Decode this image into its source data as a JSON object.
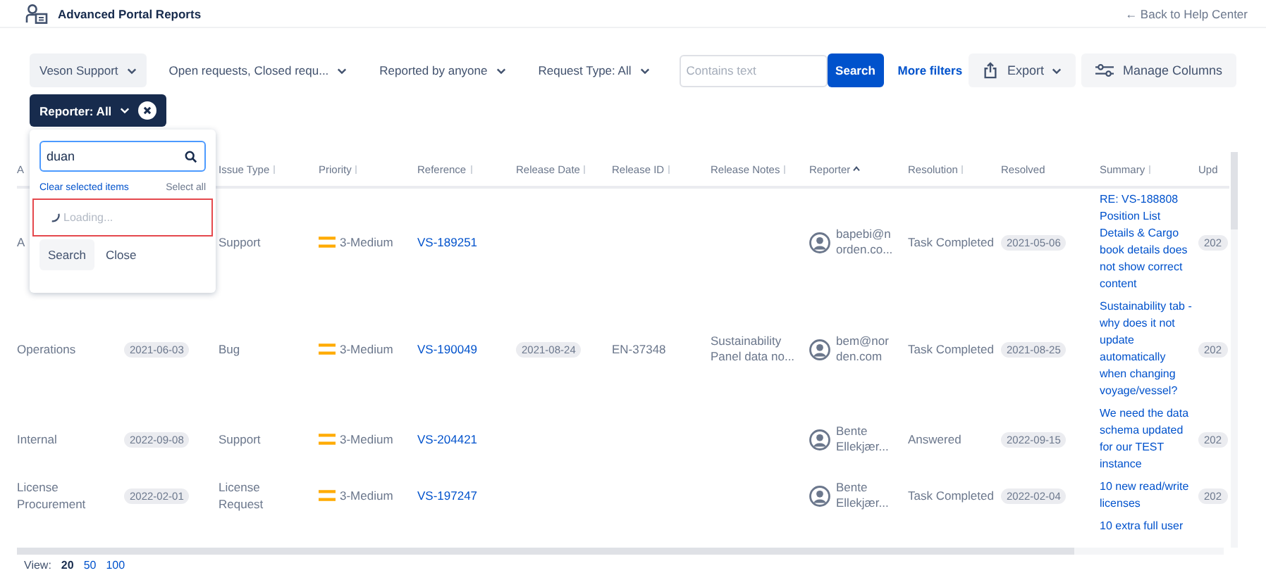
{
  "header": {
    "title": "Advanced Portal Reports",
    "back_link": "← Back to Help Center"
  },
  "filters": [
    {
      "label": "Veson Support",
      "highlighted": true
    },
    {
      "label": "Open requests, Closed requ...",
      "highlighted": false
    },
    {
      "label": "Reported by anyone",
      "highlighted": false
    },
    {
      "label": "Request Type: All",
      "highlighted": false
    }
  ],
  "search": {
    "placeholder": "Contains text",
    "button": "Search"
  },
  "more_filters": "More filters",
  "actions": [
    {
      "label": "Export",
      "kind": "export"
    },
    {
      "label": "Manage Columns",
      "kind": "columns"
    }
  ],
  "reporter_chip": {
    "label": "Reporter: All"
  },
  "reporter_popup": {
    "query": "duan",
    "clear": "Clear selected items",
    "select_all": "Select all",
    "status": "Loading...",
    "highlighted": true,
    "buttons": [
      "Search",
      "Close"
    ]
  },
  "table": {
    "columns": [
      {
        "label": "A",
        "sortable": false,
        "sorted": false
      },
      {
        "label": "Issue Type",
        "sortable": true,
        "sorted": false
      },
      {
        "label": "Priority",
        "sortable": true,
        "sorted": false
      },
      {
        "label": "Reference",
        "sortable": true,
        "sorted": false
      },
      {
        "label": "Release Date",
        "sortable": true,
        "sorted": false
      },
      {
        "label": "Release ID",
        "sortable": true,
        "sorted": false
      },
      {
        "label": "Release Notes",
        "sortable": true,
        "sorted": false
      },
      {
        "label": "Reporter",
        "sortable": true,
        "sorted": true
      },
      {
        "label": "Resolution",
        "sortable": true,
        "sorted": false
      },
      {
        "label": "Resolved",
        "sortable": false,
        "sorted": false
      },
      {
        "label": "Summary",
        "sortable": true,
        "sorted": false
      },
      {
        "label": "Upd",
        "sortable": false,
        "sorted": false
      }
    ],
    "rows": [
      {
        "col_1": "A",
        "issue_type": "Support",
        "priority": "3-Medium",
        "reference": "VS-189251",
        "reporter": [
          "bapebi@n",
          "orden.co..."
        ],
        "resolution": "Task Completed",
        "resolved": "2021-05-06",
        "summary": "RE: VS-188808 Position List Details & Cargo book details does not show correct content",
        "updated": "202"
      },
      {
        "col_1": "Operations",
        "col_2": "2021-06-03",
        "issue_type": "Bug",
        "priority": "3-Medium",
        "reference": "VS-190049",
        "release_date": "2021-08-24",
        "release_id": "EN-37348",
        "release_notes": [
          "Sustainability",
          "Panel data no..."
        ],
        "reporter": [
          "bem@nor",
          "den.com"
        ],
        "resolution": "Task Completed",
        "resolved": "2021-08-25",
        "summary": "Sustainability tab - why does it not update automatically when changing voyage/vessel?",
        "updated": "202"
      },
      {
        "col_1": "Internal",
        "col_2": "2022-09-08",
        "issue_type": "Support",
        "priority": "3-Medium",
        "reference": "VS-204421",
        "reporter": [
          "Bente",
          "Ellekjær..."
        ],
        "resolution": "Answered",
        "resolved": "2022-09-15",
        "summary": "We need the data schema updated for our TEST instance",
        "updated": "202"
      },
      {
        "col_1": "License Procurement",
        "col_2": "2022-02-01",
        "issue_type": "License Request",
        "priority": "3-Medium",
        "reference": "VS-197247",
        "reporter": [
          "Bente",
          "Ellekjær..."
        ],
        "resolution": "Task Completed",
        "resolved": "2022-02-04",
        "summary": "10 new read/write licenses",
        "updated": "202"
      },
      {
        "summary": "10 extra full user"
      }
    ]
  },
  "footer": {
    "label": "View:",
    "page_sizes": [
      {
        "label": "20",
        "selected": true
      },
      {
        "label": "50",
        "selected": false
      },
      {
        "label": "100",
        "selected": false
      }
    ]
  }
}
